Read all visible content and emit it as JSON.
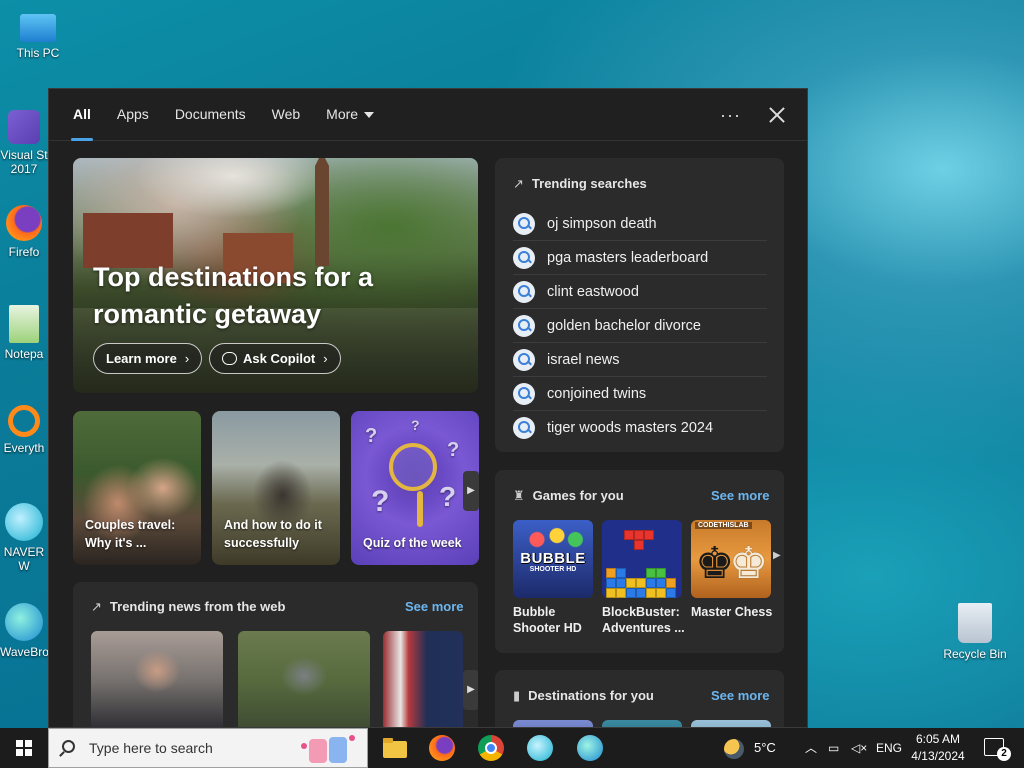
{
  "desktop": {
    "icons": [
      {
        "label": "This PC",
        "icon": "computer-icon"
      },
      {
        "label": "Visual St\n2017",
        "icon": "visual-studio-icon"
      },
      {
        "label": "Firefo",
        "icon": "firefox-icon"
      },
      {
        "label": "Notepa",
        "icon": "notepad-icon"
      },
      {
        "label": "Everyth",
        "icon": "everything-icon"
      },
      {
        "label": "NAVER W",
        "icon": "naver-whale-icon"
      },
      {
        "label": "WaveBro",
        "icon": "wavebrowser-icon"
      },
      {
        "label": "Recycle Bin",
        "icon": "recycle-bin-icon"
      }
    ]
  },
  "search_panel": {
    "tabs": [
      {
        "label": "All",
        "active": true
      },
      {
        "label": "Apps"
      },
      {
        "label": "Documents"
      },
      {
        "label": "Web"
      },
      {
        "label": "More"
      }
    ],
    "more_options_label": "···",
    "hero": {
      "title": "Top destinations for a romantic getaway",
      "learn_more_label": "Learn more",
      "ask_copilot_label": "Ask Copilot"
    },
    "cards": [
      {
        "caption": "Couples travel: Why it's ..."
      },
      {
        "caption": "And how to do it successfully"
      },
      {
        "caption": "Quiz of the week"
      }
    ],
    "trending_news": {
      "title": "Trending news from the web",
      "see_more": "See more"
    },
    "trending_searches": {
      "title": "Trending searches",
      "items": [
        "oj simpson death",
        "pga masters leaderboard",
        "clint eastwood",
        "golden bachelor divorce",
        "israel news",
        "conjoined twins",
        "tiger woods masters 2024"
      ]
    },
    "games": {
      "title": "Games for you",
      "see_more": "See more",
      "items": [
        {
          "name": "Bubble Shooter HD",
          "logo_text": "BUBBLE",
          "logo_sub": "SHOOTER HD"
        },
        {
          "name": "BlockBuster: Adventures ..."
        },
        {
          "name": "Master Chess",
          "tag": "CODETHISLAB"
        }
      ]
    },
    "destinations": {
      "title": "Destinations for you",
      "see_more": "See more"
    }
  },
  "taskbar": {
    "search_placeholder": "Type here to search",
    "weather": "5°C",
    "language": "ENG",
    "time": "6:05 AM",
    "date": "4/13/2024",
    "notification_count": "2",
    "colors": {
      "accent": "#4aa3e6",
      "link": "#6cb6f0",
      "panel": "#202020",
      "card": "#2b2b2b"
    }
  }
}
